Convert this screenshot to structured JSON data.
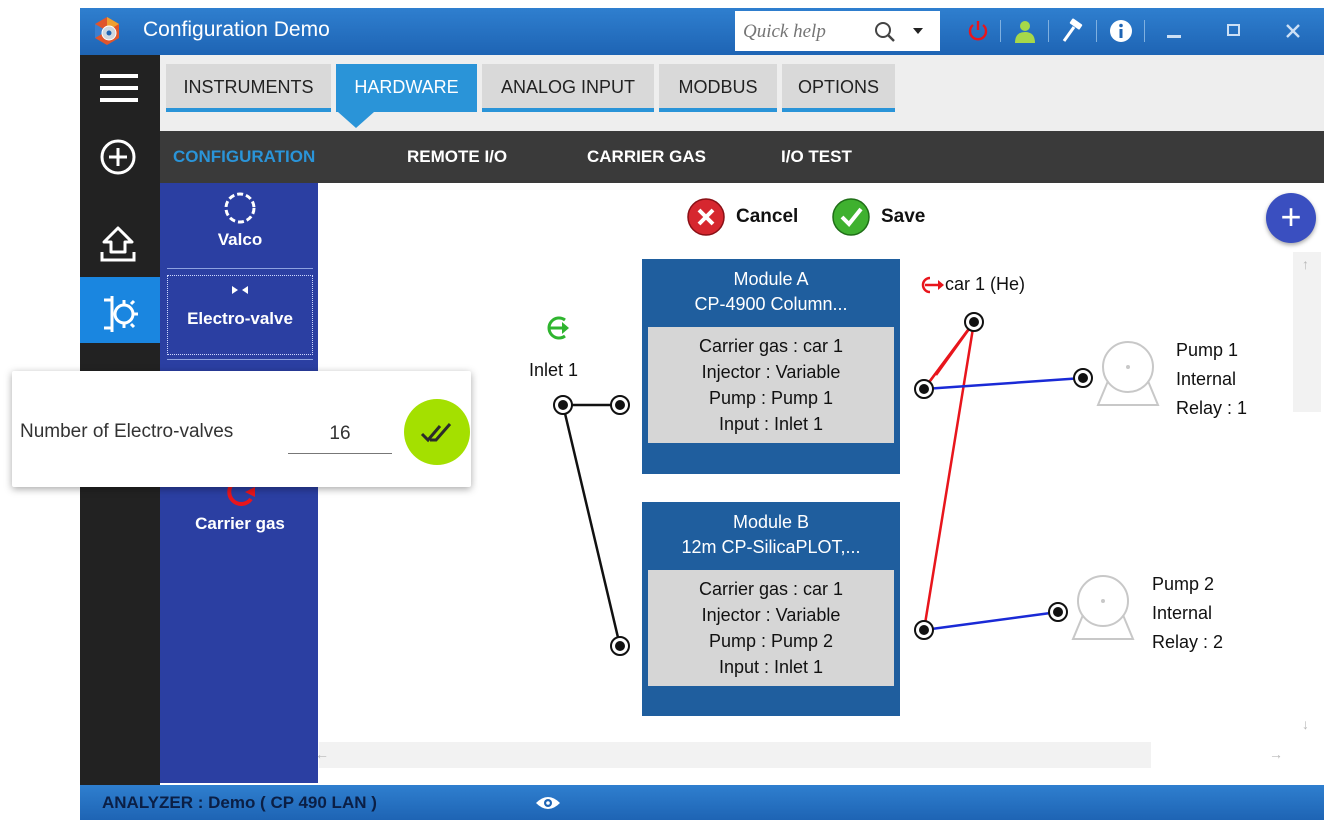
{
  "window": {
    "title": "Configuration Demo",
    "quick_help_placeholder": "Quick help"
  },
  "tabs": [
    {
      "label": "INSTRUMENTS"
    },
    {
      "label": "HARDWARE"
    },
    {
      "label": "ANALOG INPUT"
    },
    {
      "label": "MODBUS"
    },
    {
      "label": "OPTIONS"
    }
  ],
  "active_tab": "HARDWARE",
  "subtabs": [
    {
      "label": "CONFIGURATION"
    },
    {
      "label": "REMOTE I/O"
    },
    {
      "label": "CARRIER GAS"
    },
    {
      "label": "I/O TEST"
    }
  ],
  "active_subtab": "CONFIGURATION",
  "palette": {
    "items": [
      {
        "label": "Valco",
        "icon": "valco-icon"
      },
      {
        "label": "Electro-valve",
        "icon": "electro-valve-icon"
      },
      {
        "label": "Carrier gas",
        "icon": "carrier-gas-icon"
      }
    ]
  },
  "actions": {
    "cancel": "Cancel",
    "save": "Save",
    "add": "+"
  },
  "diagram": {
    "inlet": {
      "label": "Inlet 1"
    },
    "carrier": {
      "label": "car 1 (He)"
    },
    "modules": [
      {
        "title": "Module A",
        "subtitle": "CP-4900 Column...",
        "lines": [
          "Carrier gas : car 1",
          "Injector : Variable",
          "Pump : Pump 1",
          "Input : Inlet 1"
        ]
      },
      {
        "title": "Module B",
        "subtitle": "12m CP-SilicaPLOT,...",
        "lines": [
          "Carrier gas : car 1",
          "Injector : Variable",
          "Pump : Pump 2",
          "Input : Inlet 1"
        ]
      }
    ],
    "pumps": [
      {
        "lines": [
          "Pump 1",
          "Internal",
          "Relay : 1"
        ]
      },
      {
        "lines": [
          "Pump 2",
          "Internal",
          "Relay : 2"
        ]
      }
    ],
    "colors": {
      "inlet_line": "#111111",
      "carrier_line": "#e8151c",
      "pump_line": "#1a2ad6",
      "module": "#1f5e9e"
    }
  },
  "popup": {
    "label": "Number of Electro-valves",
    "value": "16"
  },
  "status": {
    "text": "ANALYZER :  Demo ( CP 490 LAN )"
  }
}
